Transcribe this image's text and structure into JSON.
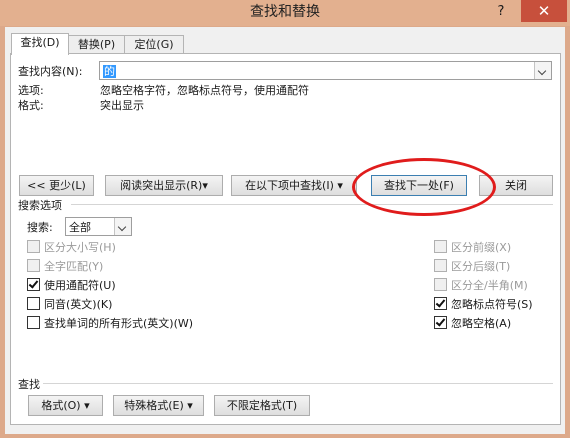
{
  "window": {
    "title": "查找和替换",
    "help": "?",
    "close": "✕"
  },
  "tabs": [
    {
      "label": "查找(D)"
    },
    {
      "label": "替换(P)"
    },
    {
      "label": "定位(G)"
    }
  ],
  "find": {
    "label": "查找内容(N):",
    "value": "的",
    "options_label": "选项:",
    "options_value": "忽略空格字符，忽略标点符号，使用通配符",
    "format_label": "格式:",
    "format_value": "突出显示"
  },
  "buttons": {
    "less": "<< 更少(L)",
    "reading_highlight": "阅读突出显示(R)▾",
    "find_in": "在以下项中查找(I) ▾",
    "find_next": "查找下一处(F)",
    "close": "关闭"
  },
  "search_options": {
    "section_label": "搜索选项",
    "search_label": "搜索:",
    "search_value": "全部"
  },
  "checkboxes": {
    "match_case": "区分大小写(H)",
    "whole_word": "全字匹配(Y)",
    "wildcards": "使用通配符(U)",
    "sounds_like": "同音(英文)(K)",
    "all_word_forms": "查找单词的所有形式(英文)(W)",
    "match_prefix": "区分前缀(X)",
    "match_suffix": "区分后缀(T)",
    "match_width": "区分全/半角(M)",
    "ignore_punct": "忽略标点符号(S)",
    "ignore_space": "忽略空格(A)"
  },
  "find_section": {
    "label": "查找",
    "format": "格式(O) ▾",
    "special": "特殊格式(E) ▾",
    "no_format": "不限定格式(T)"
  }
}
